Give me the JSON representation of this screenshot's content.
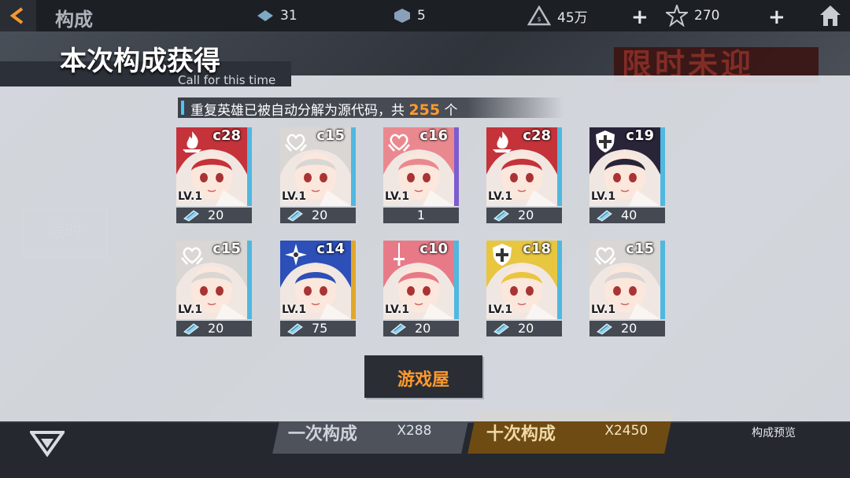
{
  "topbar": {
    "title": "构成",
    "resources": [
      {
        "icon": "diamond-icon",
        "value": "31"
      },
      {
        "icon": "cube-icon",
        "value": "5"
      },
      {
        "icon": "triangle-coin-icon",
        "value": "45万"
      },
      {
        "icon": "star-icon",
        "value": "270"
      }
    ]
  },
  "background": {
    "banner": "限时未迎",
    "side_tab": "限时",
    "buttons": [
      {
        "label": "一次构成",
        "cost": "X288"
      },
      {
        "label": "十次构成",
        "cost": "X2450"
      }
    ],
    "preview_label": "构成预览"
  },
  "result": {
    "title": "本次构成获得",
    "subtitle": "Call for this time",
    "notice_prefix": "重复英雄已被自动分解为源代码，共",
    "notice_count": "255",
    "notice_suffix": "个",
    "confirm_label": "游戏屋",
    "cards": [
      {
        "cost": "c28",
        "level": "LV.1",
        "reward": "20",
        "class": "flame-class-icon",
        "rarity": "blue",
        "accent": "#c4323a"
      },
      {
        "cost": "c15",
        "level": "LV.1",
        "reward": "20",
        "class": "heart-class-icon",
        "rarity": "blue",
        "accent": "#d9d6d4"
      },
      {
        "cost": "c16",
        "level": "LV.1",
        "reward": "1",
        "class": "heart-class-icon",
        "rarity": "purple",
        "accent": "#e9898f"
      },
      {
        "cost": "c28",
        "level": "LV.1",
        "reward": "20",
        "class": "flame-class-icon",
        "rarity": "blue",
        "accent": "#c4323a"
      },
      {
        "cost": "c19",
        "level": "LV.1",
        "reward": "40",
        "class": "shield-class-icon",
        "rarity": "blue",
        "accent": "#2a2438"
      },
      {
        "cost": "c15",
        "level": "LV.1",
        "reward": "20",
        "class": "heart-class-icon",
        "rarity": "blue",
        "accent": "#d9d6d4"
      },
      {
        "cost": "c14",
        "level": "LV.1",
        "reward": "75",
        "class": "shuriken-class-icon",
        "rarity": "gold",
        "accent": "#2c4fb8"
      },
      {
        "cost": "c10",
        "level": "LV.1",
        "reward": "20",
        "class": "sword-class-icon",
        "rarity": "blue",
        "accent": "#e87a88"
      },
      {
        "cost": "c18",
        "level": "LV.1",
        "reward": "20",
        "class": "shield-class-icon",
        "rarity": "blue",
        "accent": "#e8c640"
      },
      {
        "cost": "c15",
        "level": "LV.1",
        "reward": "20",
        "class": "heart-class-icon",
        "rarity": "blue",
        "accent": "#d9d6d4"
      }
    ]
  }
}
